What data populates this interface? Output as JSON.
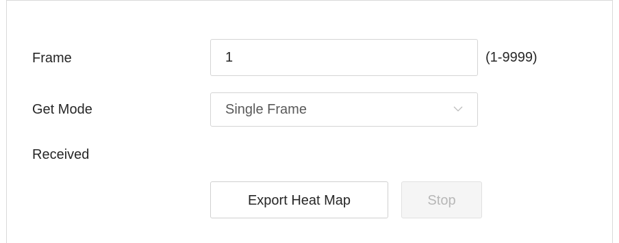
{
  "form": {
    "frame": {
      "label": "Frame",
      "value": "1",
      "hint": "(1-9999)"
    },
    "get_mode": {
      "label": "Get Mode",
      "selected": "Single Frame",
      "icon": "chevron-down-icon"
    },
    "received": {
      "label": "Received"
    }
  },
  "actions": {
    "export_label": "Export Heat Map",
    "stop_label": "Stop",
    "stop_disabled": true
  },
  "colors": {
    "border": "#d4d4d4",
    "text": "#262626",
    "muted_text": "#595959",
    "disabled_text": "#b7b7b7",
    "disabled_bg": "#f5f5f5"
  }
}
